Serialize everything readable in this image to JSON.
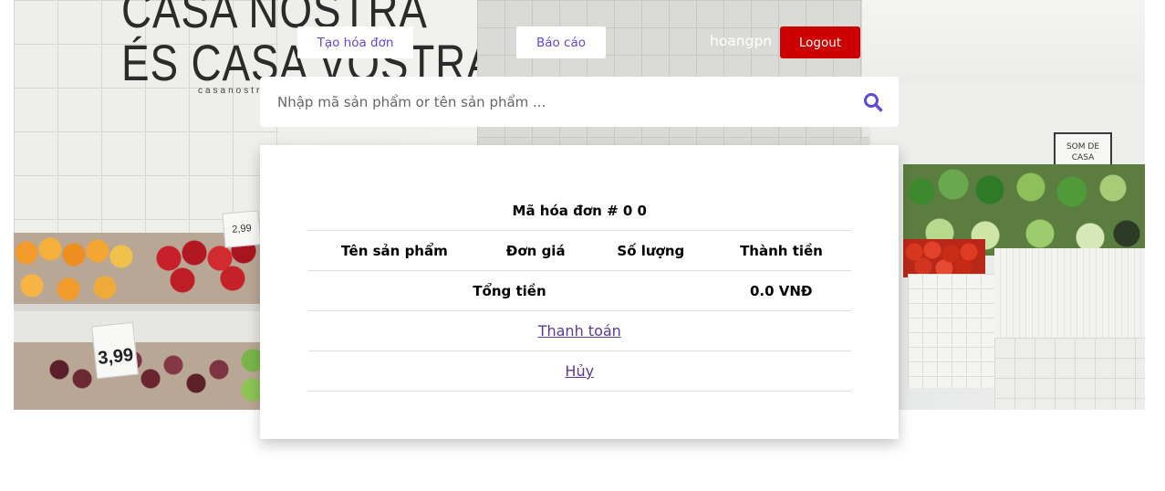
{
  "nav": {
    "create_invoice_label": "Tạo hóa đơn",
    "report_label": "Báo cáo",
    "username": "hoangpn",
    "logout_label": "Logout"
  },
  "search": {
    "placeholder": "Nhập mã sản phẩm or tên sản phẩm ...",
    "value": "",
    "icon": "search-icon"
  },
  "invoice": {
    "title": "Mã hóa đơn # 0 0",
    "columns": [
      "Tên sản phẩm",
      "Đơn giá",
      "Số lượng",
      "Thành tiền"
    ],
    "items": [],
    "total_label": "Tổng tiền",
    "total_value": "0.0 VNĐ",
    "pay_label": "Thanh toán",
    "cancel_label": "Hủy"
  },
  "background": {
    "wall_text": "ÉS CASA VOSTRA",
    "wall_text_top": "CASA NOSTRA",
    "wall_small": "casanostra",
    "price_tag": "3,99",
    "frame_text": "SOM DE CASA NOSTRA"
  },
  "colors": {
    "accent": "#5b4bd6",
    "logout": "#cc0000",
    "link": "#5b3a8f"
  }
}
